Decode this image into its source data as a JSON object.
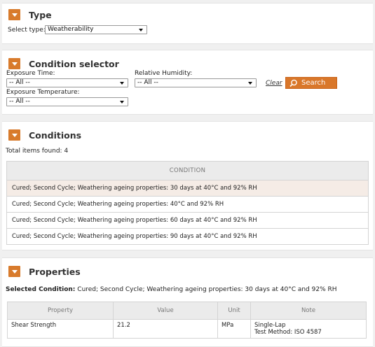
{
  "type_panel": {
    "title": "Type",
    "select_label": "Select type:",
    "select_value": "Weatherability"
  },
  "condition_selector": {
    "title": "Condition selector",
    "exposure_time_label": "Exposure Time:",
    "exposure_time_value": "-- All --",
    "relative_humidity_label": "Relative Humidity:",
    "relative_humidity_value": "-- All --",
    "exposure_temperature_label": "Exposure Temperature:",
    "exposure_temperature_value": "-- All --",
    "clear_label": "Clear",
    "search_label": "Search"
  },
  "conditions": {
    "title": "Conditions",
    "total_label": "Total items found: 4",
    "column_header": "CONDITION",
    "rows": [
      "Cured; Second Cycle; Weathering ageing properties: 30 days at 40°C and 92% RH",
      "Cured; Second Cycle; Weathering ageing properties: 40°C and 92% RH",
      "Cured; Second Cycle; Weathering ageing properties: 60 days at 40°C and 92% RH",
      "Cured; Second Cycle; Weathering ageing properties: 90 days at 40°C and 92% RH"
    ]
  },
  "properties": {
    "title": "Properties",
    "selected_label": "Selected Condition:",
    "selected_value": "Cured; Second Cycle; Weathering ageing properties: 30 days at 40°C and 92% RH",
    "columns": [
      "Property",
      "Value",
      "Unit",
      "Note"
    ],
    "rows": [
      {
        "property": "Shear Strength",
        "value": "21.2",
        "unit": "MPa",
        "note_line1": "Single-Lap",
        "note_line2": "Test Method: ISO 4587"
      }
    ]
  },
  "colors": {
    "accent": "#d87b2c",
    "selected_row": "#f5ece6",
    "header_bg": "#ebebeb"
  },
  "icons": {
    "panel_toggle": "chevron-down-icon",
    "select_caret": "caret-down-icon",
    "search": "search-icon"
  }
}
